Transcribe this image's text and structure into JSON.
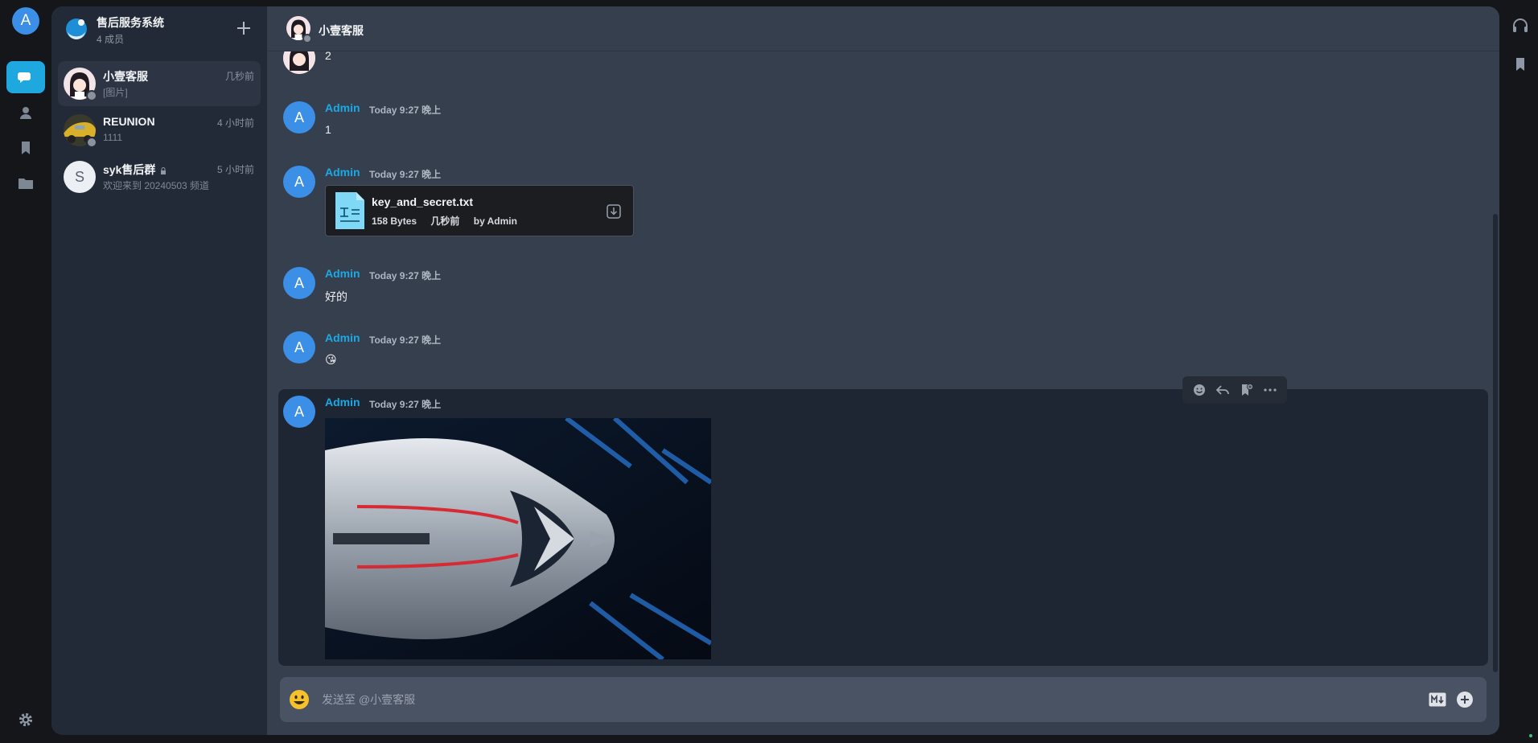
{
  "user": {
    "avatar_letter": "A"
  },
  "group": {
    "name": "售后服务系统",
    "members": "4 成员"
  },
  "conversations": [
    {
      "name": "小壹客服",
      "preview": "[图片]",
      "time": "几秒前",
      "active": true
    },
    {
      "name": "REUNION",
      "preview": "1111",
      "time": "4 小时前"
    },
    {
      "name": "syk售后群",
      "preview": "欢迎来到 20240503 频道",
      "time": "5 小时前",
      "avatar_letter": "S"
    }
  ],
  "chat": {
    "title": "小壹客服"
  },
  "messages": [
    {
      "text": "2"
    },
    {
      "author": "Admin",
      "time": "Today 9:27 晚上",
      "avatar_letter": "A",
      "text": "1"
    },
    {
      "author": "Admin",
      "time": "Today 9:27 晚上",
      "avatar_letter": "A",
      "file": {
        "name": "key_and_secret.txt",
        "size": "158 Bytes",
        "when": "几秒前",
        "by": "by Admin"
      }
    },
    {
      "author": "Admin",
      "time": "Today 9:27 晚上",
      "avatar_letter": "A",
      "text": "好的"
    },
    {
      "author": "Admin",
      "time": "Today 9:27 晚上",
      "avatar_letter": "A",
      "text": "😘"
    },
    {
      "author": "Admin",
      "time": "Today 9:27 晚上",
      "avatar_letter": "A",
      "image": "futuristic-car-image"
    }
  ],
  "composer": {
    "placeholder": "发送至 @小壹客服"
  },
  "colors": {
    "accent": "#1fa8e0",
    "author": "#1ba9e6",
    "avatar": "#3b8fe6"
  }
}
